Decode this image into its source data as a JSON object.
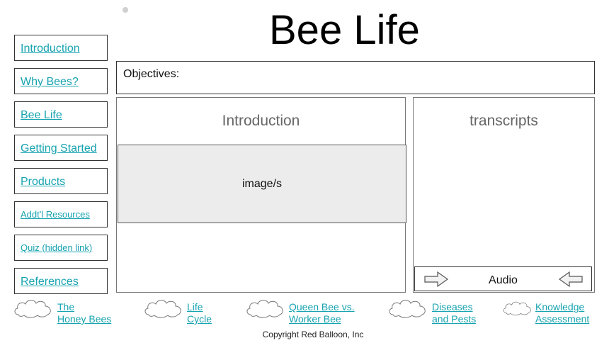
{
  "page": {
    "title": "Bee Life"
  },
  "nav": {
    "items": [
      {
        "label": "Introduction"
      },
      {
        "label": "Why Bees?"
      },
      {
        "label": "Bee Life"
      },
      {
        "label": "Getting Started"
      },
      {
        "label": "Products"
      },
      {
        "label": "Addt'l Resources"
      },
      {
        "label": "Quiz (hidden link)"
      },
      {
        "label": "References"
      }
    ]
  },
  "objectives": {
    "label": "Objectives:"
  },
  "content": {
    "title": "Introduction",
    "image_placeholder": "image/s"
  },
  "transcripts": {
    "title": "transcripts"
  },
  "audio": {
    "label": "Audio"
  },
  "bottom_nav": {
    "items": [
      {
        "line1": "The",
        "line2": "Honey Bees"
      },
      {
        "line1": "Life",
        "line2": "Cycle"
      },
      {
        "line1": "Queen Bee vs.",
        "line2": "Worker Bee"
      },
      {
        "line1": "Diseases",
        "line2": "and Pests"
      },
      {
        "line1": "Knowledge",
        "line2": "Assessment"
      }
    ]
  },
  "footer": {
    "copyright": "Copyright Red Balloon, Inc"
  },
  "colors": {
    "link": "#17a3b0",
    "image_bg": "#ececec",
    "panel_title": "#666666"
  },
  "icons": {
    "next": "right-arrow-icon",
    "prev": "left-arrow-icon",
    "cloud": "cloud-icon"
  }
}
